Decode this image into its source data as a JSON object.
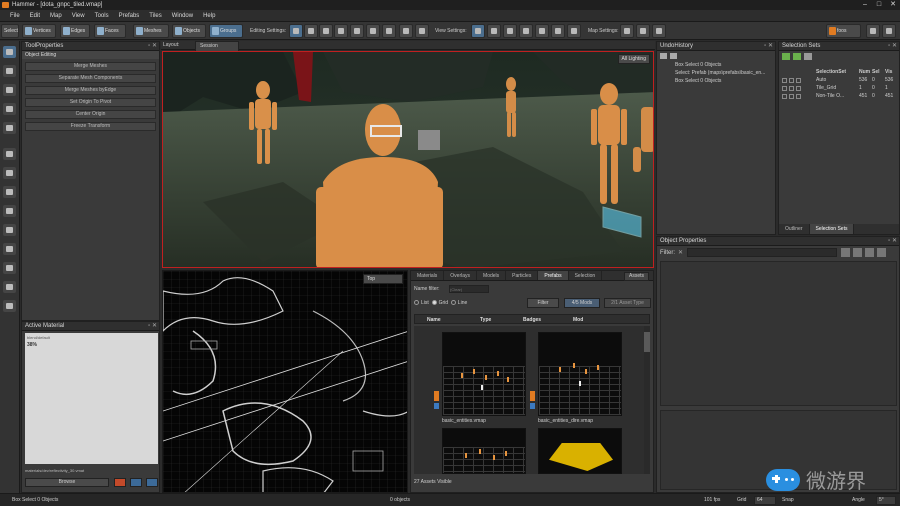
{
  "window": {
    "title": "Hammer - [dota_gnpc_tiled.vmap]"
  },
  "menu": [
    "File",
    "Edit",
    "Map",
    "View",
    "Tools",
    "Prefabs",
    "Tiles",
    "Window",
    "Help"
  ],
  "toolbar": {
    "select_label": "Selects",
    "modes": [
      "Vertices",
      "Edges",
      "Faces",
      "Meshes",
      "Objects",
      "Groups"
    ],
    "editing_settings": "Editing Settings:",
    "view_settings": "View Settings:",
    "map_settings": "Map Settings:",
    "user": "foos"
  },
  "tool_properties": {
    "title": "ToolProperties",
    "section": "Object Editing",
    "buttons": [
      "Merge Meshes",
      "Separate Mesh Components",
      "Merge Meshes byEdge",
      "Set Origin To Pivot",
      "Center Origin",
      "Freeze Transform"
    ]
  },
  "layout": {
    "label": "Layout:",
    "value": "Session Options"
  },
  "viewport": {
    "lighting": "All Lighting",
    "top_label": "Top"
  },
  "active_material": {
    "title": "Active Material",
    "lines": [
      "blend/default",
      "38%"
    ],
    "path": "materials/dev/reflectivity_30.vmat",
    "browse": "Browse"
  },
  "undo": {
    "title": "UndoHistory",
    "items": [
      "Box Select 0 Objects",
      "Select: Prefab (maps\\prefabs\\basic_en...",
      "Box Select 0 Objects"
    ]
  },
  "selection_sets": {
    "title": "Selection Sets",
    "headers": [
      "SelectionSet",
      "Num",
      "Sel",
      "Vis"
    ],
    "rows": [
      {
        "name": "Auto",
        "num": "536",
        "sel": "0",
        "vis": "536"
      },
      {
        "name": "Tile_Grid",
        "num": "1",
        "sel": "0",
        "vis": "1"
      },
      {
        "name": "Non-Tile O...",
        "num": "451",
        "sel": "0",
        "vis": "451"
      }
    ],
    "tabs": [
      "Outliner",
      "Selection Sets"
    ]
  },
  "object_properties": {
    "title": "Object Properties",
    "filter_label": "Filter:"
  },
  "asset_browser": {
    "tabs": [
      "Materials",
      "Overlays",
      "Models",
      "Particles",
      "Prefabs",
      "Selection"
    ],
    "assets_btn": "Assets",
    "name_filter_label": "Name filter:",
    "name_filter_placeholder": "(Clear)",
    "view_modes": [
      "List",
      "Grid",
      "Line"
    ],
    "filter_btn": "Filter",
    "mods_btn": "4/5 Mods",
    "asset_type_btn": "2/1 Asset Type",
    "columns": [
      "Name",
      "Type",
      "Badges",
      "Mod"
    ],
    "thumbs": [
      "basic_entities.vmap",
      "basic_entities_dire.vmap"
    ],
    "status": "27 Assets Visible"
  },
  "status_bar": {
    "left": "Box Select 0 Objects",
    "middle": "0 objects",
    "fps": "101 fps",
    "grid_label": "Grid",
    "grid_value": "64",
    "snap_label": "Snap",
    "angle_label": "Angle",
    "angle_value": "5°"
  },
  "watermark": {
    "text": "微游界"
  },
  "colors": {
    "accent": "#4b6e8e",
    "viewport_border": "#c02020"
  }
}
